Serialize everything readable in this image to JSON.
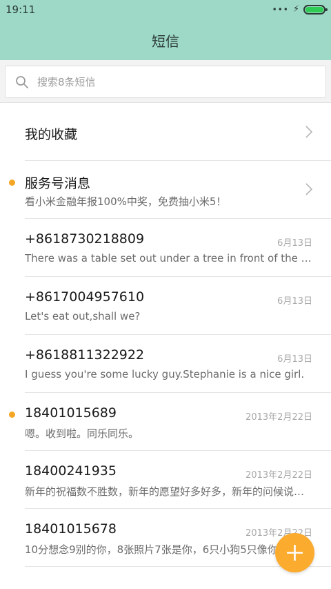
{
  "status_bar": {
    "time": "19:11",
    "signal_dots": "•••"
  },
  "header": {
    "title": "短信"
  },
  "search": {
    "placeholder": "搜索8条短信"
  },
  "favorites": {
    "label": "我的收藏"
  },
  "service": {
    "name": "服务号消息",
    "snippet": "看小米金融年报100%中奖，免费抽小米5！",
    "unread": true
  },
  "conversations": [
    {
      "name": "+8618730218809",
      "snippet": "There was a table set out under a tree in front of the house",
      "date": "6月13日"
    },
    {
      "name": "+8617004957610",
      "snippet": "Let's eat out,shall we?",
      "date": "6月13日"
    },
    {
      "name": "+8618811322922",
      "snippet": "I guess you're some lucky guy.Stephanie is a nice girl.",
      "date": "6月13日"
    },
    {
      "name": "18401015689",
      "snippet": "嗯。收到啦。同乐同乐。",
      "date": "2013年2月22日",
      "unread": true
    },
    {
      "name": "18400241935",
      "snippet": "新年的祝福数不胜数，新年的愿望好多好多，新年的问候说也说不完",
      "date": "2013年2月22日"
    },
    {
      "name": "18401015678",
      "snippet": "10分想念9别的你，8张照片7张是你，6只小狗5只像你",
      "date": "2013年2月22日"
    }
  ],
  "colors": {
    "header_bg": "#9ed8c6",
    "accent": "#fbab2d",
    "unread_dot": "#f5a623"
  },
  "icons": {
    "search": "search-icon",
    "chevron": "chevron-right-icon",
    "compose": "plus-icon"
  }
}
